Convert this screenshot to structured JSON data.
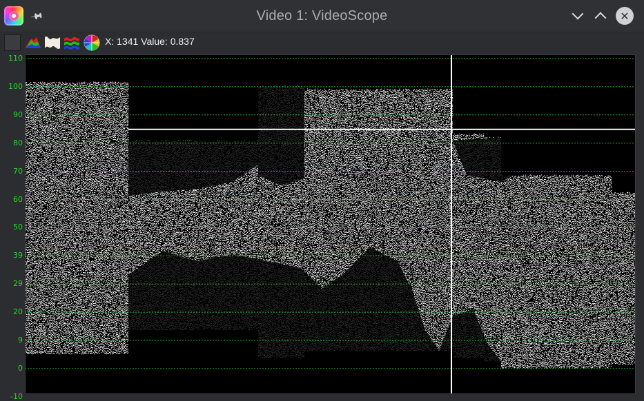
{
  "window": {
    "title": "Video 1: VideoScope",
    "app_icon": "cinelerra-icon",
    "pin_icon": "pin-icon",
    "minimize_icon": "chevron-down-icon",
    "maximize_icon": "chevron-up-icon",
    "close_icon": "close-icon"
  },
  "toolbar": {
    "buttons": [
      {
        "name": "black-swatch-button",
        "icon": "swatch-icon"
      },
      {
        "name": "histogram-button",
        "icon": "histogram-icon"
      },
      {
        "name": "waveform-button",
        "icon": "waveform-icon"
      },
      {
        "name": "rgb-parade-button",
        "icon": "rgb-parade-icon"
      },
      {
        "name": "vectorscope-button",
        "icon": "vectorscope-icon"
      }
    ],
    "readout": "X: 1341 Value: 0.837"
  },
  "scope": {
    "y_ticks": [
      "110",
      "100",
      "90",
      "80",
      "70",
      "60",
      "50",
      "39",
      "29",
      "20",
      "9",
      "0",
      "-10"
    ],
    "grid_color": "#27d927",
    "background": "#000000",
    "trace_color": "#ffffff",
    "cursor_x_value": 1341,
    "cursor_value": 0.837
  }
}
